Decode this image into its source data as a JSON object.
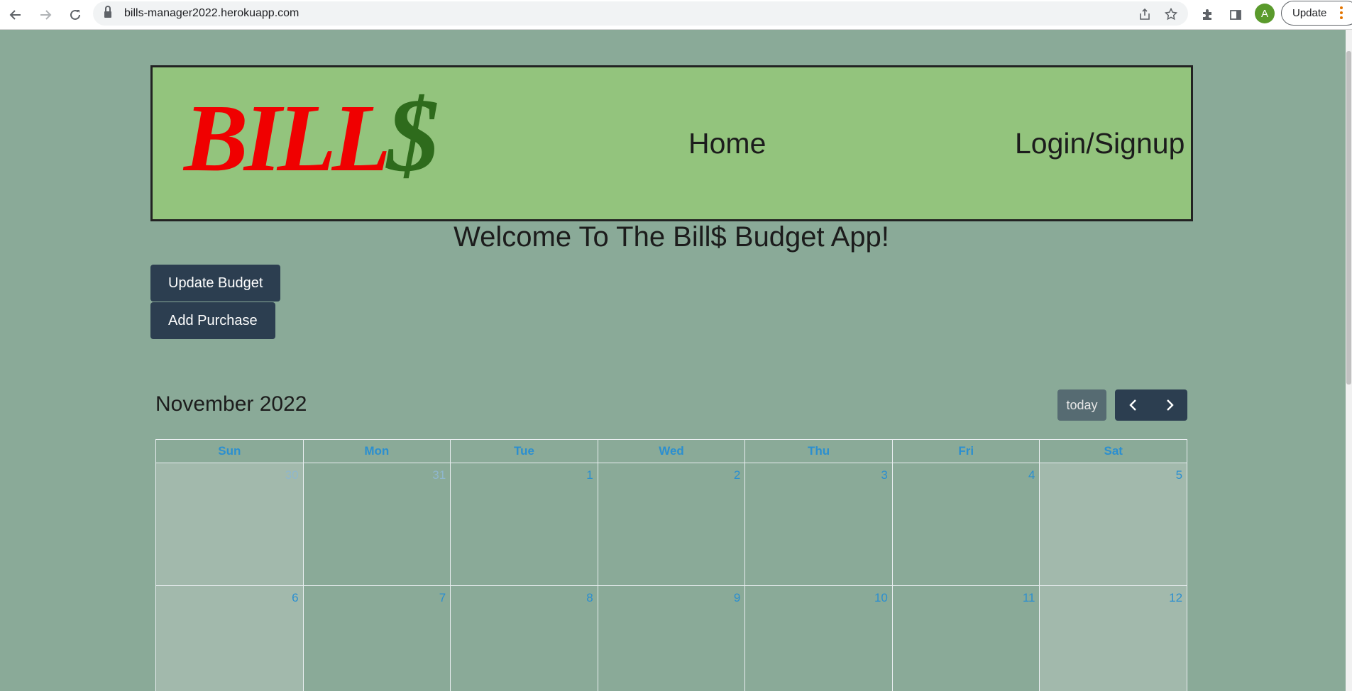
{
  "browser": {
    "url": "bills-manager2022.herokuapp.com",
    "avatar_initial": "A",
    "update_label": "Update"
  },
  "header": {
    "logo_text": "BILL",
    "logo_symbol": "$",
    "nav": {
      "home": "Home",
      "login": "Login/Signup"
    }
  },
  "welcome": "Welcome To The Bill$ Budget App!",
  "actions": {
    "update_budget": "Update Budget",
    "add_purchase": "Add Purchase"
  },
  "calendar": {
    "title": "November 2022",
    "today_label": "today",
    "days": [
      "Sun",
      "Mon",
      "Tue",
      "Wed",
      "Thu",
      "Fri",
      "Sat"
    ],
    "week1": [
      "30",
      "31",
      "1",
      "2",
      "3",
      "4",
      "5"
    ],
    "week2": [
      "6",
      "7",
      "8",
      "9",
      "10",
      "11",
      "12"
    ]
  },
  "colors": {
    "page_bg": "#8aaa98",
    "header_bg": "#93c47d",
    "logo_red": "#f00000",
    "logo_green": "#2e6b1c",
    "button_dark": "#2c3e50",
    "day_link": "#2b8fd0"
  }
}
